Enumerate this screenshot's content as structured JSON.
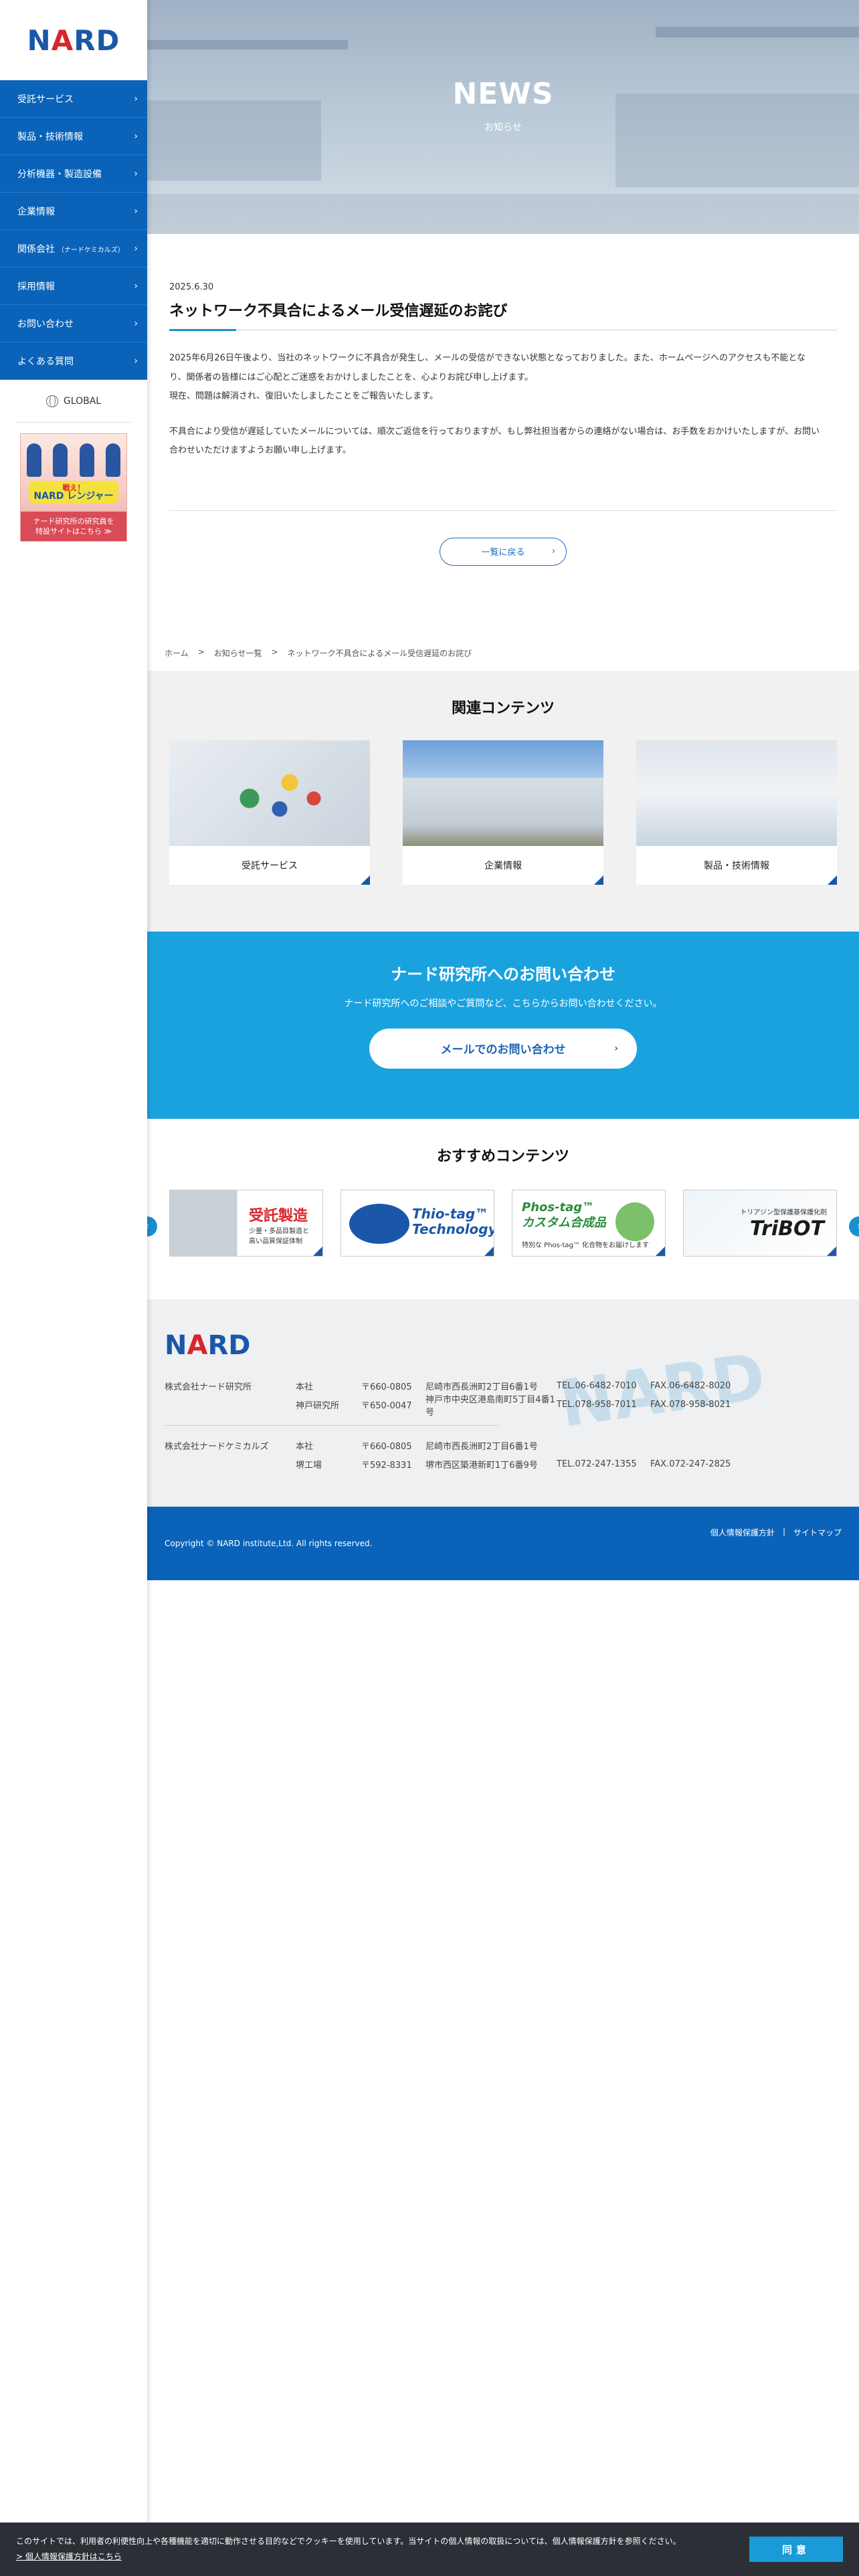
{
  "brand": {
    "logo_left": "N",
    "logo_accent": "A",
    "logo_right": "RD"
  },
  "sidebar": {
    "items": [
      {
        "label": "受託サービス",
        "sub": ""
      },
      {
        "label": "製品・技術情報",
        "sub": ""
      },
      {
        "label": "分析機器・製造設備",
        "sub": ""
      },
      {
        "label": "企業情報",
        "sub": ""
      },
      {
        "label": "関係会社",
        "sub": "（ナードケミカルズ）"
      },
      {
        "label": "採用情報",
        "sub": ""
      },
      {
        "label": "お問い合わせ",
        "sub": ""
      },
      {
        "label": "よくある質問",
        "sub": ""
      }
    ],
    "global_label": "GLOBAL",
    "banner": {
      "tag_small": "戦え！",
      "tag_main": "NARD レンジャー",
      "bottom_line1": "ナード研究所の研究員を",
      "bottom_line2": "特設サイトはこちら ≫"
    }
  },
  "hero": {
    "title": "NEWS",
    "subtitle": "お知らせ"
  },
  "article": {
    "date": "2025.6.30",
    "title": "ネットワーク不具合によるメール受信遅延のお詫び",
    "p1_lines": [
      "2025年6月26日午後より、当社のネットワークに不具合が発生し、メールの受信ができない状態となっておりました。また、ホームページへのアクセスも不能とな",
      "り、関係者の皆様にはご心配とご迷惑をおかけしましたことを、心よりお詫び申し上げます。",
      "現在、問題は解消され、復旧いたしましたことをご報告いたします。"
    ],
    "p2_lines": [
      "不具合により受信が遅延していたメールについては、順次ご返信を行っておりますが、もし弊社担当者からの連絡がない場合は、お手数をおかけいたしますが、お問い",
      "合わせいただけますようお願い申し上げます。"
    ],
    "back_label": "一覧に戻る"
  },
  "breadcrumb": {
    "home": "ホーム",
    "list": "お知らせ一覧",
    "current": "ネットワーク不具合によるメール受信遅延のお詫び",
    "sep": ">"
  },
  "related": {
    "title": "関連コンテンツ",
    "cards": [
      {
        "label": "受託サービス"
      },
      {
        "label": "企業情報"
      },
      {
        "label": "製品・技術情報"
      }
    ]
  },
  "contact": {
    "title": "ナード研究所へのお問い合わせ",
    "desc": "ナード研究所へのご相談やご質問など、こちらからお問い合わせください。",
    "mail_label": "メールでのお問い合わせ"
  },
  "reco": {
    "title": "おすすめコンテンツ",
    "items": [
      {
        "title": "受託製造",
        "sub1": "少量・多品目製造と",
        "sub2": "高い品質保証体制"
      },
      {
        "title1": "Thio-tag™",
        "title2": "Technology"
      },
      {
        "title1": "Phos-tag™",
        "title2": "カスタム合成品",
        "sub": "特別な Phos-tag™ 化合物をお届けします"
      },
      {
        "sub": "トリアジン型保護基保護化剤",
        "title": "TriBOT"
      }
    ]
  },
  "footer": {
    "logo_left": "N",
    "logo_accent": "A",
    "logo_right": "RD",
    "offices": [
      {
        "company": "株式会社ナード研究所",
        "branch": "本社",
        "zip": "〒660-0805",
        "addr": "尼崎市西長洲町2丁目6番1号",
        "tel": "TEL.06-6482-7010",
        "fax": "FAX.06-6482-8020"
      },
      {
        "company": "",
        "branch": "神戸研究所",
        "zip": "〒650-0047",
        "addr": "神戸市中央区港島南町5丁目4番1号",
        "tel": "TEL.078-958-7011",
        "fax": "FAX.078-958-8021"
      },
      {
        "company": "株式会社ナードケミカルズ",
        "branch": "本社",
        "zip": "〒660-0805",
        "addr": "尼崎市西長洲町2丁目6番1号",
        "tel": "",
        "fax": ""
      },
      {
        "company": "",
        "branch": "堺工場",
        "zip": "〒592-8331",
        "addr": "堺市西区築港新町1丁6番9号",
        "tel": "TEL.072-247-1355",
        "fax": "FAX.072-247-2825"
      }
    ],
    "copyright": "Copyright © NARD institute,Ltd. All rights reserved.",
    "privacy": "個人情報保護方針",
    "link_sep": "|",
    "sitemap": "サイトマップ"
  },
  "cookie": {
    "text": "このサイトでは、利用者の利便性向上や各種機能を適切に動作させる目的などでクッキーを使用しています。当サイトの個人情報の取扱については、個人情報保護方針を参照ください。",
    "link": "> 個人情報保護方針はこちら",
    "agree": "同意"
  }
}
